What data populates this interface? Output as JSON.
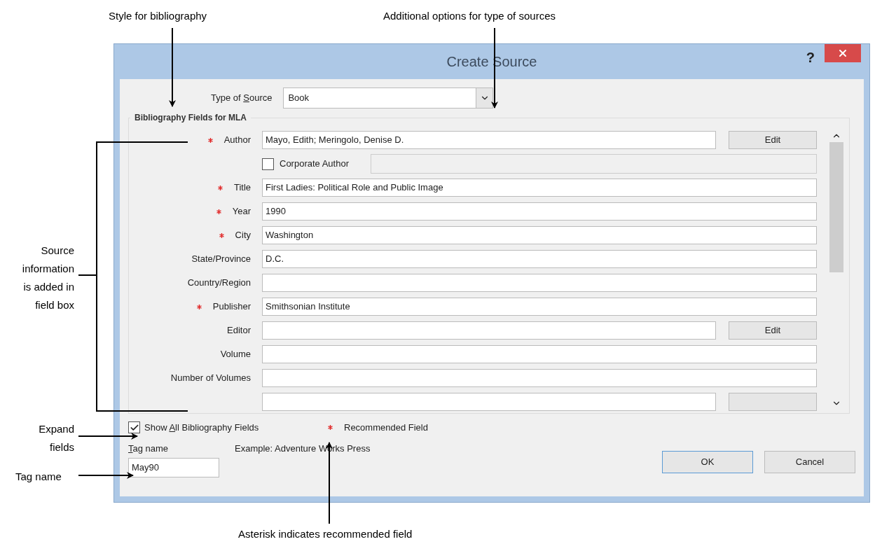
{
  "annotations": [
    {
      "text": "Style for bibliography"
    },
    {
      "text": "Additional options for type of sources"
    },
    {
      "text": "Source information is added in field box"
    },
    {
      "text": "Expand fields"
    },
    {
      "text": "Tag name"
    },
    {
      "text": "Asterisk indicates recommended field"
    }
  ],
  "dialog": {
    "title": "Create Source",
    "help": "?",
    "type_of_source": {
      "label": {
        "before": "Type of ",
        "mnemonic": "S",
        "after": "ource"
      },
      "value": "Book"
    },
    "group_title": "Bibliography Fields for MLA",
    "fields": [
      {
        "kind": "text",
        "label": "Author",
        "recommended": true,
        "value": "Mayo, Edith; Meringolo, Denise D.",
        "button": "Edit"
      },
      {
        "kind": "checkbox",
        "label": "Corporate Author",
        "checked": false,
        "disabled": true
      },
      {
        "kind": "text",
        "label": "Title",
        "recommended": true,
        "value": "First Ladies: Political Role and Public Image"
      },
      {
        "kind": "text",
        "label": "Year",
        "recommended": true,
        "value": "1990"
      },
      {
        "kind": "text",
        "label": "City",
        "recommended": true,
        "value": "Washington"
      },
      {
        "kind": "text",
        "label": "State/Province",
        "recommended": false,
        "value": "D.C."
      },
      {
        "kind": "text",
        "label": "Country/Region",
        "recommended": false
      },
      {
        "kind": "text",
        "label": "Publisher",
        "recommended": true,
        "value": "Smithsonian Institute"
      },
      {
        "kind": "text",
        "label": "Editor",
        "recommended": false,
        "button": "Edit"
      },
      {
        "kind": "text",
        "label": "Volume",
        "recommended": false
      },
      {
        "kind": "text",
        "label": "Number of Volumes",
        "recommended": false
      },
      {
        "kind": "clipped"
      }
    ],
    "show_all": {
      "label": {
        "before": "Show ",
        "mnemonic": "A",
        "after": "ll Bibliography Fields"
      },
      "checked": true
    },
    "legend": "Recommended Field",
    "tag_name": {
      "label": {
        "mnemonic": "T",
        "after": "ag name"
      },
      "value": "May90"
    },
    "example": "Example: Adventure Works Press",
    "buttons": [
      {
        "label": "OK",
        "default": true
      },
      {
        "label": "Cancel",
        "default": false
      }
    ]
  }
}
